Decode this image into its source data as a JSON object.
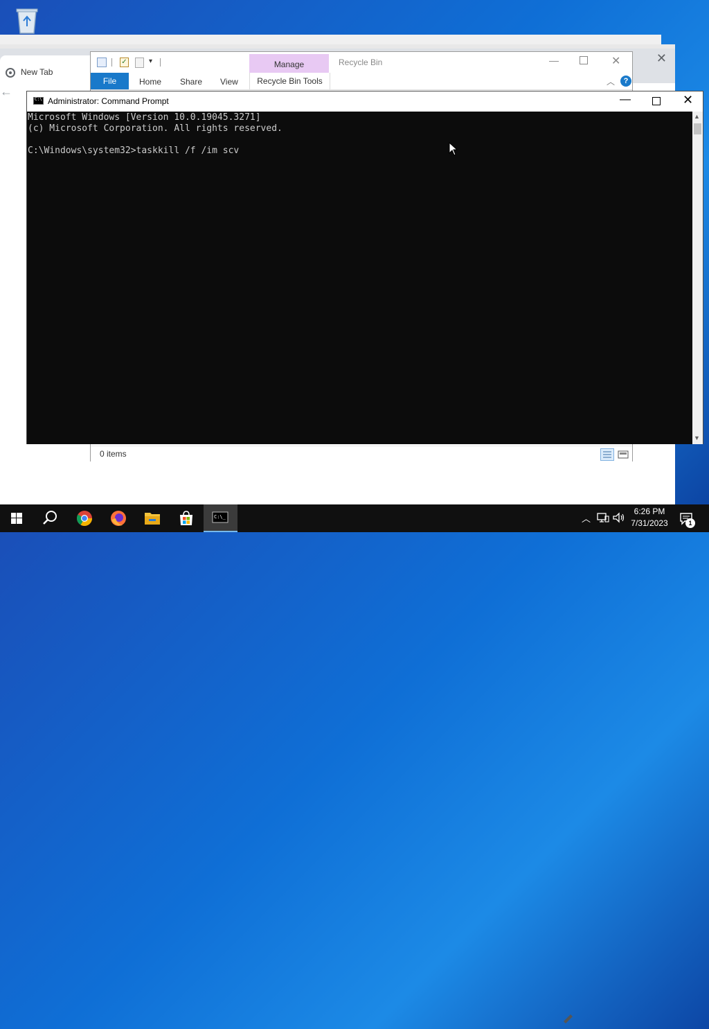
{
  "desktop": {
    "recycle_bin_icon": "recycle-bin-icon"
  },
  "browser": {
    "tab_label": "New Tab",
    "close_glyph": "✕",
    "back_glyph": "←"
  },
  "explorer": {
    "title": "Recycle Bin",
    "manage_label": "Manage",
    "tabs": {
      "file": "File",
      "home": "Home",
      "share": "Share",
      "view": "View",
      "recycle_bin_tools": "Recycle Bin Tools"
    },
    "help_glyph": "?",
    "chevron_glyph": "︿",
    "status_text": "0 items",
    "min_glyph": "—",
    "close_glyph": "✕",
    "qat_dropdown_glyph": "▾",
    "qat_check_glyph": "✓"
  },
  "cmd": {
    "title": "Administrator: Command Prompt",
    "min_glyph": "—",
    "close_glyph": "✕",
    "lines": [
      "Microsoft Windows [Version 10.0.19045.3271]",
      "(c) Microsoft Corporation. All rights reserved.",
      "",
      "C:\\Windows\\system32>taskkill /f /im scv"
    ],
    "scroll_up_glyph": "▲",
    "scroll_down_glyph": "▼"
  },
  "taskbar": {
    "apps": [
      "start-icon",
      "search-icon",
      "chrome-icon",
      "firefox-icon",
      "file-explorer-icon",
      "microsoft-store-icon",
      "command-prompt-icon"
    ],
    "tray_chevron": "︿",
    "time": "6:26 PM",
    "date": "7/31/2023",
    "notification_count": "1"
  },
  "colors": {
    "accent": "#1979ca",
    "manage_tab": "#e8c9f3",
    "console_bg": "#0c0c0c",
    "console_text": "#cccccc",
    "taskbar_bg": "#101010"
  }
}
